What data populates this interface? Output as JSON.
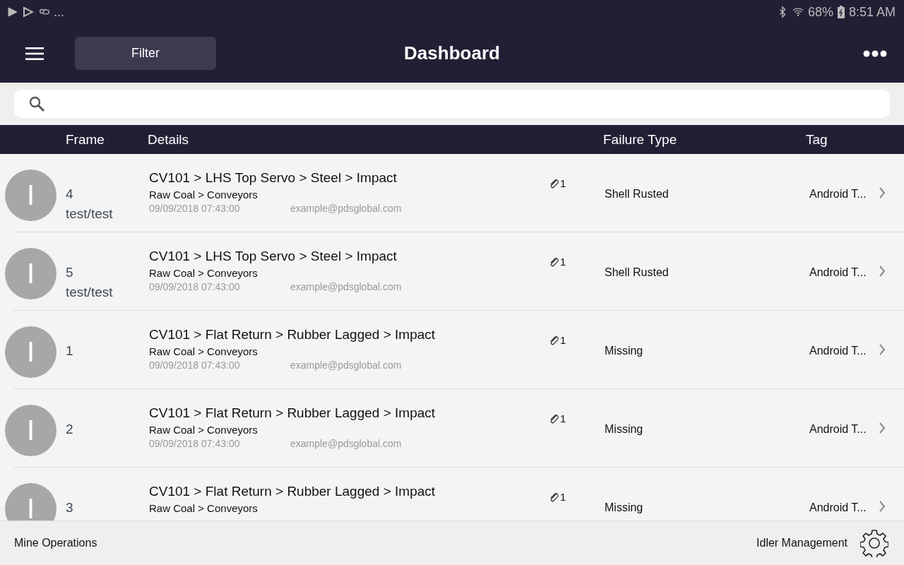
{
  "status_bar": {
    "overflow": "...",
    "battery": "68%",
    "time": "8:51 AM"
  },
  "app_bar": {
    "filter_button": "Filter",
    "title": "Dashboard"
  },
  "table": {
    "columns": [
      "Frame",
      "Details",
      "Failure Type",
      "Tag"
    ],
    "rows": [
      {
        "avatar": "I",
        "frame": "4",
        "frame_sub": "test/test",
        "title": "CV101 > LHS Top Servo > Steel > Impact",
        "path": "Raw Coal > Conveyors",
        "date": "09/09/2018 07:43:00",
        "email": "example@pdsglobal.com",
        "attachments": "1",
        "failure_type": "Shell Rusted",
        "tag": "Android T..."
      },
      {
        "avatar": "I",
        "frame": "5",
        "frame_sub": "test/test",
        "title": "CV101 > LHS Top Servo > Steel > Impact",
        "path": "Raw Coal > Conveyors",
        "date": "09/09/2018 07:43:00",
        "email": "example@pdsglobal.com",
        "attachments": "1",
        "failure_type": "Shell Rusted",
        "tag": "Android T..."
      },
      {
        "avatar": "I",
        "frame": "1",
        "title": "CV101 > Flat Return > Rubber Lagged > Impact",
        "path": "Raw Coal > Conveyors",
        "date": "09/09/2018 07:43:00",
        "email": "example@pdsglobal.com",
        "attachments": "1",
        "failure_type": "Missing",
        "tag": "Android T..."
      },
      {
        "avatar": "I",
        "frame": "2",
        "title": "CV101 > Flat Return > Rubber Lagged > Impact",
        "path": "Raw Coal > Conveyors",
        "date": "09/09/2018 07:43:00",
        "email": "example@pdsglobal.com",
        "attachments": "1",
        "failure_type": "Missing",
        "tag": "Android T..."
      },
      {
        "avatar": "I",
        "frame": "3",
        "title": "CV101 > Flat Return > Rubber Lagged > Impact",
        "path": "Raw Coal > Conveyors",
        "attachments": "1",
        "failure_type": "Missing",
        "tag": "Android T..."
      }
    ]
  },
  "bottom_bar": {
    "left": "Mine Operations",
    "right": "Idler Management"
  }
}
